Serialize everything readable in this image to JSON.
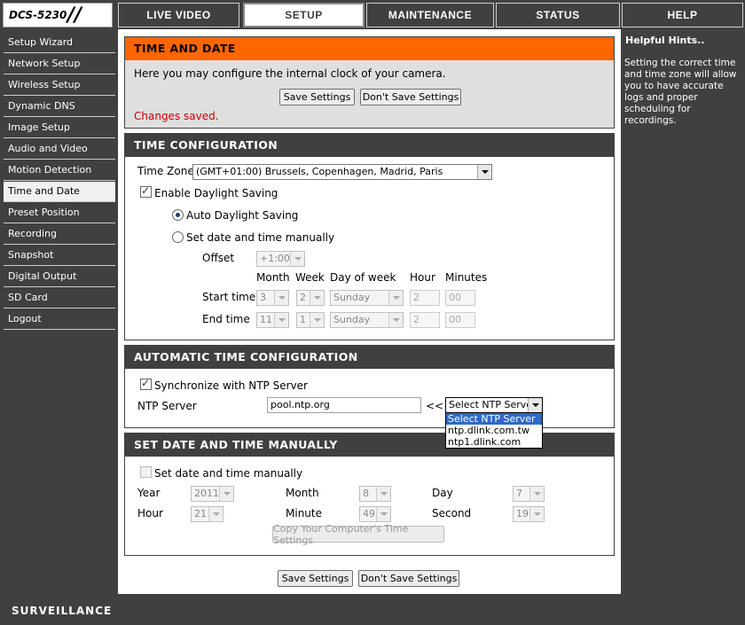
{
  "header": {
    "model": "DCS-5230",
    "tabs": [
      "LIVE VIDEO",
      "SETUP",
      "MAINTENANCE",
      "STATUS",
      "HELP"
    ],
    "active_tab": "SETUP"
  },
  "sidebar": {
    "items": [
      {
        "label": "Setup Wizard"
      },
      {
        "label": "Network Setup"
      },
      {
        "label": "Wireless Setup"
      },
      {
        "label": "Dynamic DNS"
      },
      {
        "label": "Image Setup"
      },
      {
        "label": "Audio and Video"
      },
      {
        "label": "Motion Detection"
      },
      {
        "label": "Time and Date"
      },
      {
        "label": "Preset Position"
      },
      {
        "label": "Recording"
      },
      {
        "label": "Snapshot"
      },
      {
        "label": "Digital Output"
      },
      {
        "label": "SD Card"
      },
      {
        "label": "Logout"
      }
    ],
    "active_index": 7
  },
  "intro": {
    "title": "TIME AND DATE",
    "description": "Here you may configure the internal clock of your camera.",
    "save_label": "Save Settings",
    "dont_save_label": "Don't Save Settings",
    "status": "Changes saved."
  },
  "time_config": {
    "title": "TIME CONFIGURATION",
    "timezone_label": "Time Zone",
    "timezone_value": "(GMT+01:00) Brussels, Copenhagen, Madrid, Paris",
    "enable_dst_label": "Enable Daylight Saving",
    "enable_dst_checked": true,
    "auto_dst_label": "Auto Daylight Saving",
    "manual_dst_label": "Set date and time manually",
    "offset_label": "Offset",
    "offset_value": "+1:00",
    "col_month": "Month",
    "col_week": "Week",
    "col_dow": "Day of week",
    "col_hour": "Hour",
    "col_minutes": "Minutes",
    "start_label": "Start time",
    "start": {
      "month": "3",
      "week": "2",
      "dow": "Sunday",
      "hour": "2",
      "minutes": "00"
    },
    "end_label": "End time",
    "end": {
      "month": "11",
      "week": "1",
      "dow": "Sunday",
      "hour": "2",
      "minutes": "00"
    }
  },
  "auto_time": {
    "title": "AUTOMATIC TIME CONFIGURATION",
    "sync_label": "Synchronize with NTP Server",
    "sync_checked": true,
    "ntp_label": "NTP Server",
    "ntp_value": "pool.ntp.org",
    "arrow_label": "<<",
    "ntp_select_value": "Select NTP Server",
    "ntp_options": [
      "Select NTP Server",
      "ntp.dlink.com.tw",
      "ntp1.dlink.com"
    ]
  },
  "manual_time": {
    "title": "SET DATE AND TIME MANUALLY",
    "set_manual_label": "Set date and time manually",
    "year_label": "Year",
    "year_value": "2011",
    "month_label": "Month",
    "month_value": "8",
    "day_label": "Day",
    "day_value": "7",
    "hour_label": "Hour",
    "hour_value": "21",
    "minute_label": "Minute",
    "minute_value": "49",
    "second_label": "Second",
    "second_value": "19",
    "copy_label": "Copy Your Computer's Time Settings"
  },
  "bottom": {
    "save_label": "Save Settings",
    "dont_save_label": "Don't Save Settings"
  },
  "help": {
    "title": "Helpful Hints..",
    "text": "Setting the correct time and time zone will allow you to have accurate logs and proper scheduling for recordings."
  },
  "footer": {
    "brand": "SURVEILLANCE"
  },
  "colors": {
    "chrome": "#404040",
    "accent_orange": "#ff6600",
    "status_red": "#cc0000",
    "selection_blue": "#3169c6"
  }
}
